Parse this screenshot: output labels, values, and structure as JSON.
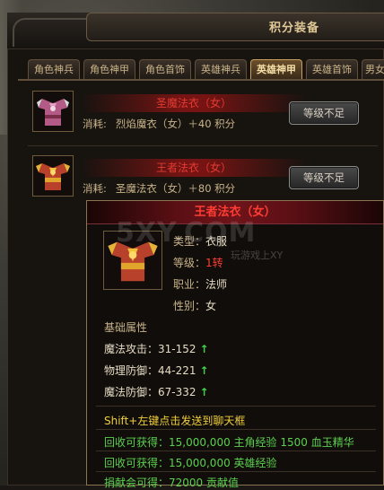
{
  "window": {
    "title": "积分装备"
  },
  "tabs": [
    {
      "label": "角色神兵",
      "active": false
    },
    {
      "label": "角色神甲",
      "active": false
    },
    {
      "label": "角色首饰",
      "active": false
    },
    {
      "label": "英雄神兵",
      "active": false
    },
    {
      "label": "英雄神甲",
      "active": true
    },
    {
      "label": "英雄首饰",
      "active": false
    },
    {
      "label": "男女",
      "active": false
    }
  ],
  "items": [
    {
      "name": "圣魔法衣（女）",
      "cost_label": "消耗:",
      "cost_value": "烈焰魔衣（女）＋40 积分",
      "button": "等级不足"
    },
    {
      "name": "王者法衣（女）",
      "cost_label": "消耗:",
      "cost_value": "圣魔法衣（女）＋80 积分",
      "button": "等级不足"
    }
  ],
  "tooltip": {
    "title": "王者法衣（女）",
    "type_label": "类型：",
    "type_value": "衣服",
    "level_label": "等级：",
    "level_value": "1转",
    "class_label": "职业：",
    "class_value": "法师",
    "gender_label": "性别：",
    "gender_value": "女",
    "base_title": "基础属性",
    "stats": [
      {
        "label": "魔法攻击：",
        "value": "31-152"
      },
      {
        "label": "物理防御：",
        "value": "44-221"
      },
      {
        "label": "魔法防御：",
        "value": "67-332"
      }
    ],
    "shift_hint": "Shift+左键点击发送到聊天框",
    "recycle_1": "回收可获得：15,000,000 主角经验 1500 血玉精华",
    "recycle_2": "回收可获得：15,000,000 英雄经验",
    "donate": "捐献会可得：72000 贡献值"
  },
  "watermark": {
    "big": "5XY.COM",
    "small": "玩游戏上XY"
  }
}
